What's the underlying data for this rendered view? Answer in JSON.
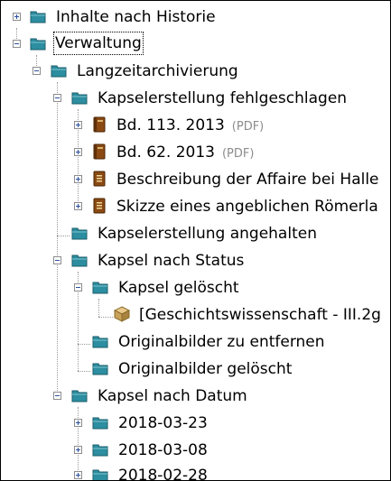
{
  "tree": {
    "items": [
      {
        "label": "Inhalte nach Historie",
        "icon": "folder-icon"
      },
      {
        "label": "Verwaltung",
        "icon": "folder-icon"
      },
      {
        "label": "Langzeitarchivierung",
        "icon": "folder-icon"
      },
      {
        "label": "Kapselerstellung fehlgeschlagen",
        "icon": "folder-icon"
      },
      {
        "label": "Bd. 113. 2013",
        "badge": "(PDF)",
        "icon": "book-icon"
      },
      {
        "label": "Bd. 62. 2013",
        "badge": "(PDF)",
        "icon": "book-icon"
      },
      {
        "label": "Beschreibung der Affaire bei Halle",
        "icon": "document-icon"
      },
      {
        "label": "Skizze eines angeblichen Römerla",
        "icon": "document-icon"
      },
      {
        "label": "Kapselerstellung angehalten",
        "icon": "folder-icon"
      },
      {
        "label": "Kapsel nach Status",
        "icon": "folder-icon"
      },
      {
        "label": "Kapsel gelöscht",
        "icon": "folder-icon"
      },
      {
        "label": "[Geschichtswissenschaft - III.2g",
        "icon": "package-icon"
      },
      {
        "label": "Originalbilder zu entfernen",
        "icon": "folder-icon"
      },
      {
        "label": "Originalbilder gelöscht",
        "icon": "folder-icon"
      },
      {
        "label": "Kapsel nach Datum",
        "icon": "folder-icon"
      },
      {
        "label": "2018-03-23",
        "icon": "folder-icon"
      },
      {
        "label": "2018-03-08",
        "icon": "folder-icon"
      },
      {
        "label": "2018-02-28",
        "icon": "folder-icon"
      }
    ]
  },
  "colors": {
    "folder": "#2c8ea0",
    "book": "#8a4a12",
    "connector": "#9a9a9a",
    "expander_sign": "#2b4f9c",
    "badge_text": "#8c8c8c"
  }
}
